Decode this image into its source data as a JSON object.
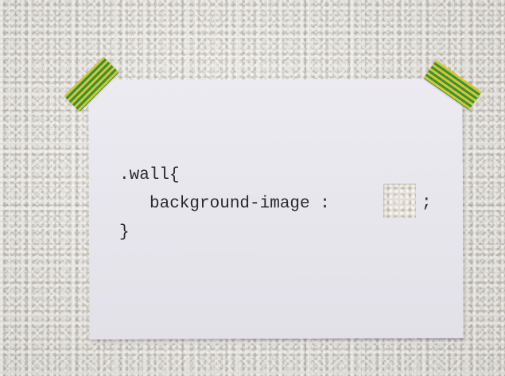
{
  "photo": {
    "code_lines": [
      ".wall{",
      "background-image : ",
      "}"
    ],
    "semicolon": ";",
    "tape_colors": [
      "#d9c42a",
      "#2f8f2f"
    ],
    "wall_color": "#e9e6df",
    "paper_color": "#ecebf1"
  }
}
